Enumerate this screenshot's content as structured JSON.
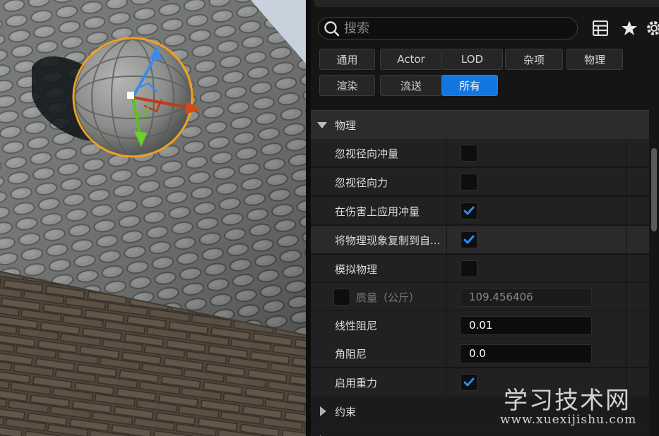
{
  "search": {
    "placeholder": "搜索"
  },
  "toolbar": {
    "table_icon": "table-view-icon",
    "favorite_icon": "star-icon",
    "settings_icon": "gear-icon"
  },
  "tabs": [
    {
      "label": "通用"
    },
    {
      "label": "Actor"
    },
    {
      "label": "LOD"
    },
    {
      "label": "杂项"
    },
    {
      "label": "物理"
    },
    {
      "label": "渲染"
    },
    {
      "label": "流送"
    },
    {
      "label": "所有",
      "active": true
    }
  ],
  "section": {
    "title": "物理"
  },
  "properties": [
    {
      "label": "忽视径向冲量",
      "type": "checkbox",
      "checked": false
    },
    {
      "label": "忽视径向力",
      "type": "checkbox",
      "checked": false
    },
    {
      "label": "在伤害上应用冲量",
      "type": "checkbox",
      "checked": true
    },
    {
      "label": "将物理现象复制到自...",
      "type": "checkbox",
      "checked": true
    },
    {
      "label": "模拟物理",
      "type": "checkbox",
      "checked": false
    },
    {
      "label": "质量（公斤）",
      "type": "number",
      "value": "109.456406",
      "enabled": false,
      "override_checked": false
    },
    {
      "label": "线性阻尼",
      "type": "number",
      "value": "0.01"
    },
    {
      "label": "角阻尼",
      "type": "number",
      "value": "0.0"
    },
    {
      "label": "启用重力",
      "type": "checkbox",
      "checked": true
    }
  ],
  "collapsed_sections": [
    {
      "title": "约束"
    }
  ],
  "watermark": {
    "text": "学习技术网",
    "url": "www.xuexijishu.com"
  },
  "colors": {
    "accent": "#1277e0",
    "gizmo_x": "#c23a1a",
    "gizmo_y": "#5ac21a",
    "gizmo_z": "#3a8ae8",
    "selection": "#f0a020"
  }
}
